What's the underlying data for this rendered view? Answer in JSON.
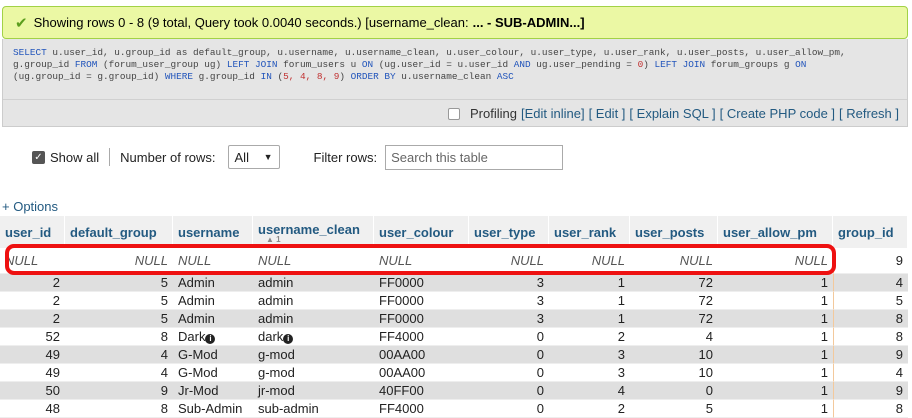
{
  "success": {
    "message": "Showing rows 0 - 8 (9 total, Query took 0.0040 seconds.) [username_clean:",
    "bold_part": "... - SUB-ADMIN...]"
  },
  "sql": {
    "line1_a": "SELECT",
    "line1_b": " u.user_id, u.group_id as default_group, u.username, u.username_clean, u.user_colour, u.user_type, u.user_rank, u.user_posts, u.user_allow_pm,",
    "line2_a": "g.group_id ",
    "line2_b": "FROM",
    "line2_c": " (forum_user_group ug) ",
    "line2_d": "LEFT JOIN",
    "line2_e": " forum_users u ",
    "line2_f": "ON",
    "line2_g": " (ug.user_id = u.user_id ",
    "line2_h": "AND",
    "line2_i": " ug.user_pending = ",
    "line2_j": "0",
    "line2_k": ") ",
    "line2_l": "LEFT JOIN",
    "line2_m": " forum_groups g ",
    "line2_n": "ON",
    "line3_a": "(ug.group_id = g.group_id) ",
    "line3_b": "WHERE",
    "line3_c": " g.group_id ",
    "line3_d": "IN",
    "line3_e": " (",
    "line3_f": "5, 4, 8, 9",
    "line3_g": ") ",
    "line3_h": "ORDER BY",
    "line3_i": " u.username_clean ",
    "line3_j": "ASC"
  },
  "toolbar": {
    "profiling_label": "Profiling",
    "edit_inline": "[Edit inline]",
    "edit": "[ Edit ]",
    "explain_sql": "[ Explain SQL ]",
    "create_php": "[ Create PHP code ]",
    "refresh": "[ Refresh ]"
  },
  "controls": {
    "show_all_label": "Show all",
    "number_of_rows_label": "Number of rows:",
    "number_of_rows_value": "All",
    "filter_rows_label": "Filter rows:",
    "filter_placeholder": "Search this table"
  },
  "options_link": "+ Options",
  "table": {
    "headers": [
      "user_id",
      "default_group",
      "username",
      "username_clean",
      "user_colour",
      "user_type",
      "user_rank",
      "user_posts",
      "user_allow_pm",
      "group_id"
    ],
    "sort_indicator": "▲ 1",
    "null_row": [
      "NULL",
      "NULL",
      "NULL",
      "NULL",
      "NULL",
      "NULL",
      "NULL",
      "NULL",
      "NULL",
      "9"
    ],
    "rows": [
      [
        "2",
        "5",
        "Admin",
        "admin",
        "FF0000",
        "3",
        "1",
        "72",
        "1",
        "4"
      ],
      [
        "2",
        "5",
        "Admin",
        "admin",
        "FF0000",
        "3",
        "1",
        "72",
        "1",
        "5"
      ],
      [
        "2",
        "5",
        "Admin",
        "admin",
        "FF0000",
        "3",
        "1",
        "72",
        "1",
        "8"
      ],
      [
        "52",
        "8",
        "Dark",
        "dark",
        "FF4000",
        "0",
        "2",
        "4",
        "1",
        "8"
      ],
      [
        "49",
        "4",
        "G-Mod",
        "g-mod",
        "00AA00",
        "0",
        "3",
        "10",
        "1",
        "9"
      ],
      [
        "49",
        "4",
        "G-Mod",
        "g-mod",
        "00AA00",
        "0",
        "3",
        "10",
        "1",
        "4"
      ],
      [
        "50",
        "9",
        "Jr-Mod",
        "jr-mod",
        "40FF00",
        "0",
        "4",
        "0",
        "1",
        "9"
      ],
      [
        "48",
        "8",
        "Sub-Admin",
        "sub-admin",
        "FF4000",
        "0",
        "2",
        "5",
        "1",
        "8"
      ]
    ]
  },
  "colors": {
    "success_bg": "#ebf8a4",
    "highlight": "#ee1111",
    "link": "#235a81"
  }
}
